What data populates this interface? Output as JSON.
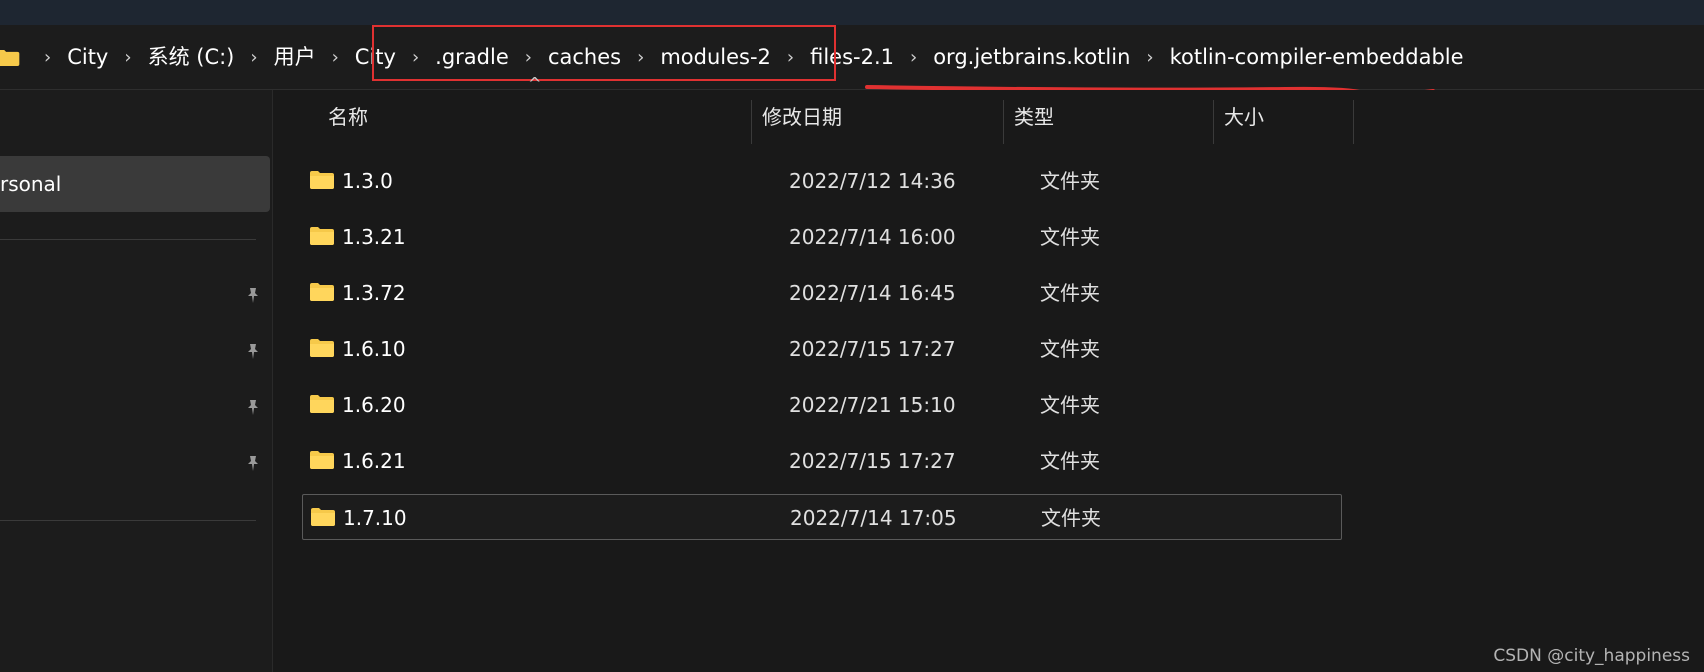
{
  "breadcrumb": {
    "items": [
      "City",
      "系统 (C:)",
      "用户",
      "City",
      ".gradle",
      "caches",
      "modules-2",
      "files-2.1",
      "org.jetbrains.kotlin",
      "kotlin-compiler-embeddable"
    ]
  },
  "sidebar": {
    "selected_label": "rsonal"
  },
  "columns": {
    "name": "名称",
    "modified": "修改日期",
    "type": "类型",
    "size": "大小"
  },
  "files": [
    {
      "name": "1.3.0",
      "modified": "2022/7/12 14:36",
      "type": "文件夹",
      "size": ""
    },
    {
      "name": "1.3.21",
      "modified": "2022/7/14 16:00",
      "type": "文件夹",
      "size": ""
    },
    {
      "name": "1.3.72",
      "modified": "2022/7/14 16:45",
      "type": "文件夹",
      "size": ""
    },
    {
      "name": "1.6.10",
      "modified": "2022/7/15 17:27",
      "type": "文件夹",
      "size": ""
    },
    {
      "name": "1.6.20",
      "modified": "2022/7/21 15:10",
      "type": "文件夹",
      "size": ""
    },
    {
      "name": "1.6.21",
      "modified": "2022/7/15 17:27",
      "type": "文件夹",
      "size": ""
    },
    {
      "name": "1.7.10",
      "modified": "2022/7/14 17:05",
      "type": "文件夹",
      "size": "",
      "selected": true
    }
  ],
  "watermark": "CSDN @city_happiness",
  "colors": {
    "background": "#191919",
    "annotation_red": "#e03131",
    "folder_yellow": "#f6c94a"
  },
  "icons": [
    "folder-icon",
    "chevron-right-icon",
    "pin-icon",
    "sort-caret-icon"
  ]
}
